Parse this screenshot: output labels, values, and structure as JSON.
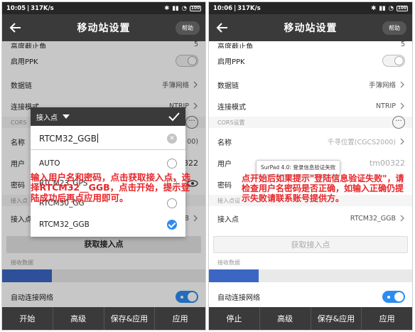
{
  "left": {
    "status": {
      "time": "10:05",
      "speed": "317K/s",
      "battery": "100"
    },
    "appbar": {
      "title": "移动站设置",
      "help": "帮助"
    },
    "rows": {
      "cutoff_label": "高度截止角",
      "cutoff_value": "5",
      "ppk_label": "启用PPK",
      "datalink_label": "数据链",
      "datalink_value": "手簿网络",
      "connmode_label": "连接模式",
      "connmode_value": "NTRIP",
      "cors_section": "CORS",
      "name_label": "名称",
      "name_value": "00)",
      "user_label": "用户",
      "user_value": "0322",
      "pwd_label": "密码",
      "mount_section": "接入点",
      "mount_label": "接入点",
      "mount_value": "GB"
    },
    "get_mount_button": "获取接入点",
    "recv_section": "接收数据",
    "auto_connect_label": "自动连接网络",
    "bottom": [
      "开始",
      "高级",
      "保存&应用",
      "应用"
    ],
    "dialog": {
      "title": "接入点",
      "input_value": "RTCM32_GGB",
      "options": [
        "AUTO",
        "RTCM23_GPS",
        "RTCM30_GG",
        "RTCM32_GGB"
      ],
      "selected": "RTCM32_GGB"
    },
    "annotation": "输入用户名和密码，点击获取接入点，选择RTCM32__GGB，点击开始，提示登陆成功后再点应用即可。"
  },
  "right": {
    "status": {
      "time": "10:06",
      "speed": "317K/s",
      "battery": "100"
    },
    "appbar": {
      "title": "移动站设置",
      "help": "帮助"
    },
    "rows": {
      "cutoff_label": "高度截止角",
      "cutoff_value": "5",
      "ppk_label": "启用PPK",
      "datalink_label": "数据链",
      "datalink_value": "手簿网络",
      "connmode_label": "连接模式",
      "connmode_value": "NTRIP",
      "cors_section": "CORS设置",
      "name_label": "名称",
      "name_value": "千寻位置(CGCS2000)",
      "user_label": "用户",
      "user_value": "tm00322",
      "pwd_label": "密码",
      "mount_section": "接入点设",
      "mount_label": "接入点",
      "mount_value": "RTCM32_GGB"
    },
    "get_mount_button": "获取接入点",
    "recv_section": "接收数据",
    "auto_connect_label": "自动连接网络",
    "bottom": [
      "停止",
      "高级",
      "保存&应用",
      "应用"
    ],
    "tooltip": "SurPad 4.0: 登录信息验证失败",
    "annotation": "点开始后如果提示\"登陆信息验证失败\"，请检查用户名密码是否正确，如输入正确仍提示失败请联系账号提供方。"
  }
}
